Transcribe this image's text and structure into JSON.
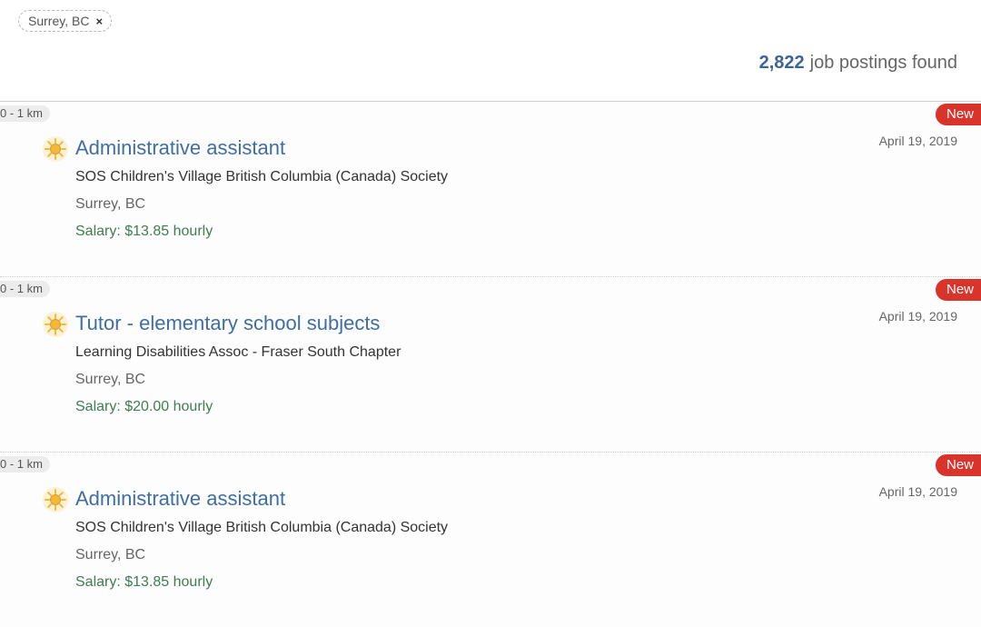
{
  "filter": {
    "label": "Surrey, BC",
    "close_icon": "×"
  },
  "results": {
    "count": "2,822",
    "label": "job postings found"
  },
  "jobs": [
    {
      "distance": "0 - 1 km",
      "badge": "New",
      "date": "April 19, 2019",
      "title": "Administrative assistant",
      "employer": "SOS Children's Village British Columbia (Canada) Society",
      "location": "Surrey, BC",
      "salary": "Salary: $13.85 hourly",
      "icon": "sun-icon"
    },
    {
      "distance": "0 - 1 km",
      "badge": "New",
      "date": "April 19, 2019",
      "title": "Tutor - elementary school subjects",
      "employer": "Learning Disabilities Assoc - Fraser South Chapter",
      "location": "Surrey, BC",
      "salary": "Salary: $20.00 hourly",
      "icon": "sun-icon"
    },
    {
      "distance": "0 - 1 km",
      "badge": "New",
      "date": "April 19, 2019",
      "title": "Administrative assistant",
      "employer": "SOS Children's Village British Columbia (Canada) Society",
      "location": "Surrey, BC",
      "salary": "Salary: $13.85 hourly",
      "icon": "sun-icon"
    }
  ],
  "colors": {
    "title": "#3e6ea3",
    "count": "#3c6496",
    "salary": "#3e7d4f",
    "badge": "#d9342b",
    "icon": "#f2b93b"
  }
}
